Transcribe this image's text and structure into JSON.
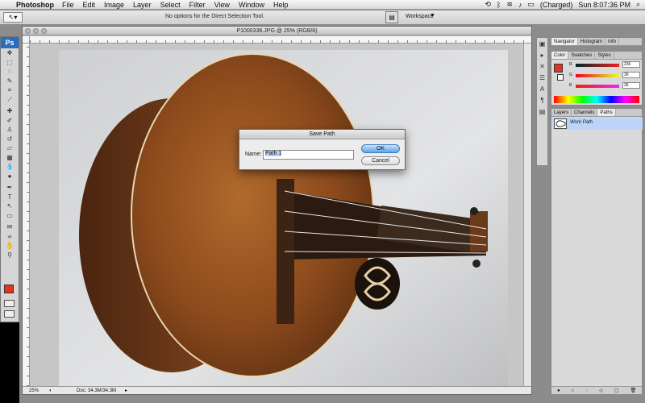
{
  "menubar": {
    "app_name": "Photoshop",
    "menus": [
      "File",
      "Edit",
      "Image",
      "Layer",
      "Select",
      "Filter",
      "View",
      "Window",
      "Help"
    ],
    "battery": "(Charged)",
    "clock": "Sun 8:07:36 PM"
  },
  "options_bar": {
    "message": "No options for the Direct Selection Tool.",
    "workspace_label": "Workspace"
  },
  "tools": {
    "logo": "Ps",
    "foreground_color": "#e5311f"
  },
  "document": {
    "title": "P1000336.JPG @ 25% (RGB/8)",
    "zoom": "25%",
    "doc_size": "Doc: 34.3M/34.3M"
  },
  "dialog": {
    "title": "Save Path",
    "name_label": "Name:",
    "name_value": "Path 1",
    "ok_label": "OK",
    "cancel_label": "Cancel"
  },
  "panels": {
    "nav_tabs": [
      "Navigator",
      "Histogram",
      "Info"
    ],
    "color_tabs": [
      "Color",
      "Swatches",
      "Styles"
    ],
    "color": {
      "r_label": "R",
      "r_value": "236",
      "g_label": "G",
      "g_value": "36",
      "b_label": "B",
      "b_value": "36"
    },
    "layer_tabs": [
      "Layers",
      "Channels",
      "Paths"
    ],
    "path_name": "Work Path"
  }
}
